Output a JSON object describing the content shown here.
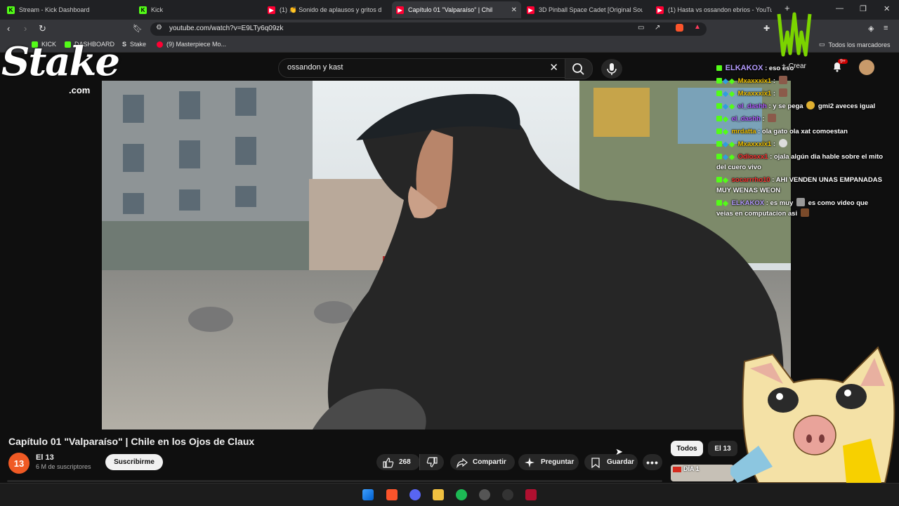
{
  "browser": {
    "tabs": [
      {
        "label": "Stream - Kick Dashboard",
        "icon": "kick-icon"
      },
      {
        "label": "Kick",
        "icon": "kick-icon"
      },
      {
        "label": "(1) 👏 Sonido de aplausos y gritos d",
        "icon": "youtube-icon"
      },
      {
        "label": "Capítulo 01 \"Valparaíso\" | Chil",
        "icon": "youtube-icon",
        "active": true
      },
      {
        "label": "3D Pinball Space Cadet [Original Sou",
        "icon": "youtube-icon"
      },
      {
        "label": "(1) Hasta vs ossandon ebrios - YouTu",
        "icon": "youtube-icon"
      }
    ],
    "url": "youtube.com/watch?v=E9LTy6q09zk",
    "bookmarks": [
      {
        "label": "KICK"
      },
      {
        "label": "DASHBOARD"
      },
      {
        "label": "Stake"
      },
      {
        "label": "(9) Masterpiece Mo..."
      }
    ],
    "all_bookmarks": "Todos los marcadores"
  },
  "youtube": {
    "search_query": "ossandon y kast",
    "create_label": "Crear",
    "notif_count": "9+",
    "video_title": "Capítulo 01 \"Valparaíso\" | Chile en los Ojos de Claux",
    "channel": {
      "name": "El 13",
      "avatar_text": "13",
      "subscribers": "6 M de suscriptores"
    },
    "subscribe": "Suscribirme",
    "likes": "268",
    "share": "Compartir",
    "ask": "Preguntar",
    "save": "Guardar",
    "chips": [
      "Todos",
      "El 13"
    ],
    "partial_text": "DÍA 1"
  },
  "overlay": {
    "stake_logo": "Stake",
    "stake_domain": ".com",
    "chat": [
      {
        "user": "ELKAKOX",
        "user_color": "#b59cff",
        "text": ": eso eso"
      },
      {
        "user": "Mxaxxxix1",
        "user_color": "#f0c000",
        "text": ":"
      },
      {
        "user": "Mxaxxxix1",
        "user_color": "#f0c000",
        "text": ":"
      },
      {
        "user": "el_dashh",
        "user_color": "#b05cff",
        "text": ": y se pega",
        "after": "gmi2 aveces igual"
      },
      {
        "user": "el_dashh",
        "user_color": "#b05cff",
        "text": ":"
      },
      {
        "user": "mrdatta",
        "user_color": "#f0c000",
        "text": ": ola gato ola xat comoestan"
      },
      {
        "user": "Mxaxxxix1",
        "user_color": "#f0c000",
        "text": ":"
      },
      {
        "user": "Odiosxx1",
        "user_color": "#ff3030",
        "text": ": ojala algún dia hable sobre el mito del cuero vivo"
      },
      {
        "user": "socarrrho10",
        "user_color": "#ff3030",
        "text": ": AHI VENDEN UNAS EMPANADAS MUY WENAS WEON"
      },
      {
        "user": "ELKAKOX",
        "user_color": "#b59cff",
        "text": ": es muy",
        "after": "es como video que veias en computacion asi"
      }
    ]
  }
}
